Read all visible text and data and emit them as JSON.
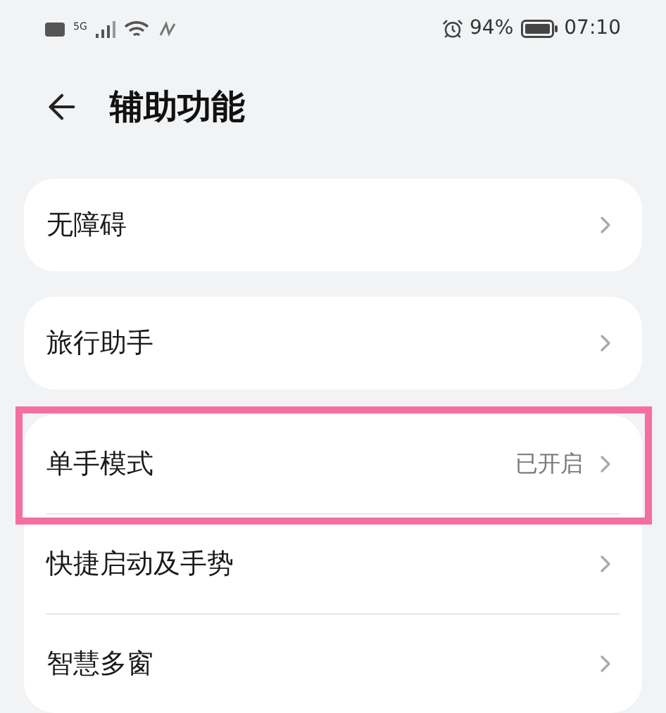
{
  "status_bar": {
    "time": "07:10",
    "battery_text": "94%",
    "network": "5G"
  },
  "header": {
    "title": "辅助功能"
  },
  "groups": [
    {
      "items": [
        {
          "label": "无障碍",
          "highlighted": false
        }
      ]
    },
    {
      "items": [
        {
          "label": "旅行助手",
          "highlighted": false
        }
      ]
    },
    {
      "items": [
        {
          "label": "单手模式",
          "value": "已开启",
          "highlighted": true
        },
        {
          "label": "快捷启动及手势",
          "highlighted": false
        },
        {
          "label": "智慧多窗",
          "highlighted": false
        }
      ]
    }
  ]
}
